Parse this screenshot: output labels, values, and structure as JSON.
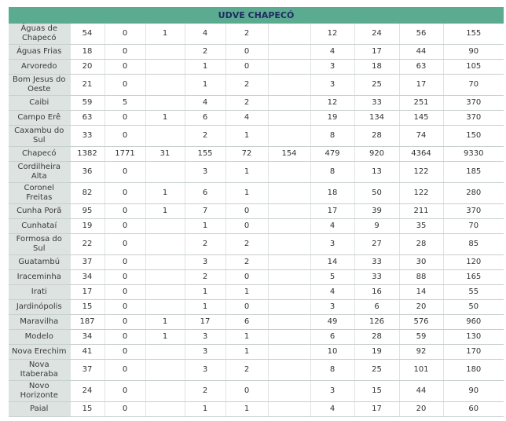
{
  "header": {
    "title": "UDVE CHAPECÓ"
  },
  "rows": [
    {
      "name": "Águas de Chapecó",
      "values": [
        "54",
        "0",
        "1",
        "4",
        "2",
        "",
        "12",
        "24",
        "56",
        "155"
      ]
    },
    {
      "name": "Águas Frias",
      "values": [
        "18",
        "0",
        "",
        "2",
        "0",
        "",
        "4",
        "17",
        "44",
        "90"
      ]
    },
    {
      "name": "Arvoredo",
      "values": [
        "20",
        "0",
        "",
        "1",
        "0",
        "",
        "3",
        "18",
        "63",
        "105"
      ]
    },
    {
      "name": "Bom Jesus do Oeste",
      "values": [
        "21",
        "0",
        "",
        "1",
        "2",
        "",
        "3",
        "25",
        "17",
        "70"
      ]
    },
    {
      "name": "Caibi",
      "values": [
        "59",
        "5",
        "",
        "4",
        "2",
        "",
        "12",
        "33",
        "251",
        "370"
      ]
    },
    {
      "name": "Campo Erê",
      "values": [
        "63",
        "0",
        "1",
        "6",
        "4",
        "",
        "19",
        "134",
        "145",
        "370"
      ]
    },
    {
      "name": "Caxambu do Sul",
      "values": [
        "33",
        "0",
        "",
        "2",
        "1",
        "",
        "8",
        "28",
        "74",
        "150"
      ]
    },
    {
      "name": "Chapecó",
      "values": [
        "1382",
        "1771",
        "31",
        "155",
        "72",
        "154",
        "479",
        "920",
        "4364",
        "9330"
      ]
    },
    {
      "name": "Cordilheira Alta",
      "values": [
        "36",
        "0",
        "",
        "3",
        "1",
        "",
        "8",
        "13",
        "122",
        "185"
      ]
    },
    {
      "name": "Coronel Freitas",
      "values": [
        "82",
        "0",
        "1",
        "6",
        "1",
        "",
        "18",
        "50",
        "122",
        "280"
      ]
    },
    {
      "name": "Cunha Porã",
      "values": [
        "95",
        "0",
        "1",
        "7",
        "0",
        "",
        "17",
        "39",
        "211",
        "370"
      ]
    },
    {
      "name": "Cunhataí",
      "values": [
        "19",
        "0",
        "",
        "1",
        "0",
        "",
        "4",
        "9",
        "35",
        "70"
      ]
    },
    {
      "name": "Formosa do Sul",
      "values": [
        "22",
        "0",
        "",
        "2",
        "2",
        "",
        "3",
        "27",
        "28",
        "85"
      ]
    },
    {
      "name": "Guatambú",
      "values": [
        "37",
        "0",
        "",
        "3",
        "2",
        "",
        "14",
        "33",
        "30",
        "120"
      ]
    },
    {
      "name": "Iraceminha",
      "values": [
        "34",
        "0",
        "",
        "2",
        "0",
        "",
        "5",
        "33",
        "88",
        "165"
      ]
    },
    {
      "name": "Irati",
      "values": [
        "17",
        "0",
        "",
        "1",
        "1",
        "",
        "4",
        "16",
        "14",
        "55"
      ]
    },
    {
      "name": "Jardinópolis",
      "values": [
        "15",
        "0",
        "",
        "1",
        "0",
        "",
        "3",
        "6",
        "20",
        "50"
      ]
    },
    {
      "name": "Maravilha",
      "values": [
        "187",
        "0",
        "1",
        "17",
        "6",
        "",
        "49",
        "126",
        "576",
        "960"
      ]
    },
    {
      "name": "Modelo",
      "values": [
        "34",
        "0",
        "1",
        "3",
        "1",
        "",
        "6",
        "28",
        "59",
        "130"
      ]
    },
    {
      "name": "Nova Erechim",
      "values": [
        "41",
        "0",
        "",
        "3",
        "1",
        "",
        "10",
        "19",
        "92",
        "170"
      ]
    },
    {
      "name": "Nova Itaberaba",
      "values": [
        "37",
        "0",
        "",
        "3",
        "2",
        "",
        "8",
        "25",
        "101",
        "180"
      ]
    },
    {
      "name": "Novo Horizonte",
      "values": [
        "24",
        "0",
        "",
        "2",
        "0",
        "",
        "3",
        "15",
        "44",
        "90"
      ]
    },
    {
      "name": "Paial",
      "values": [
        "15",
        "0",
        "",
        "1",
        "1",
        "",
        "4",
        "17",
        "20",
        "60"
      ]
    }
  ]
}
